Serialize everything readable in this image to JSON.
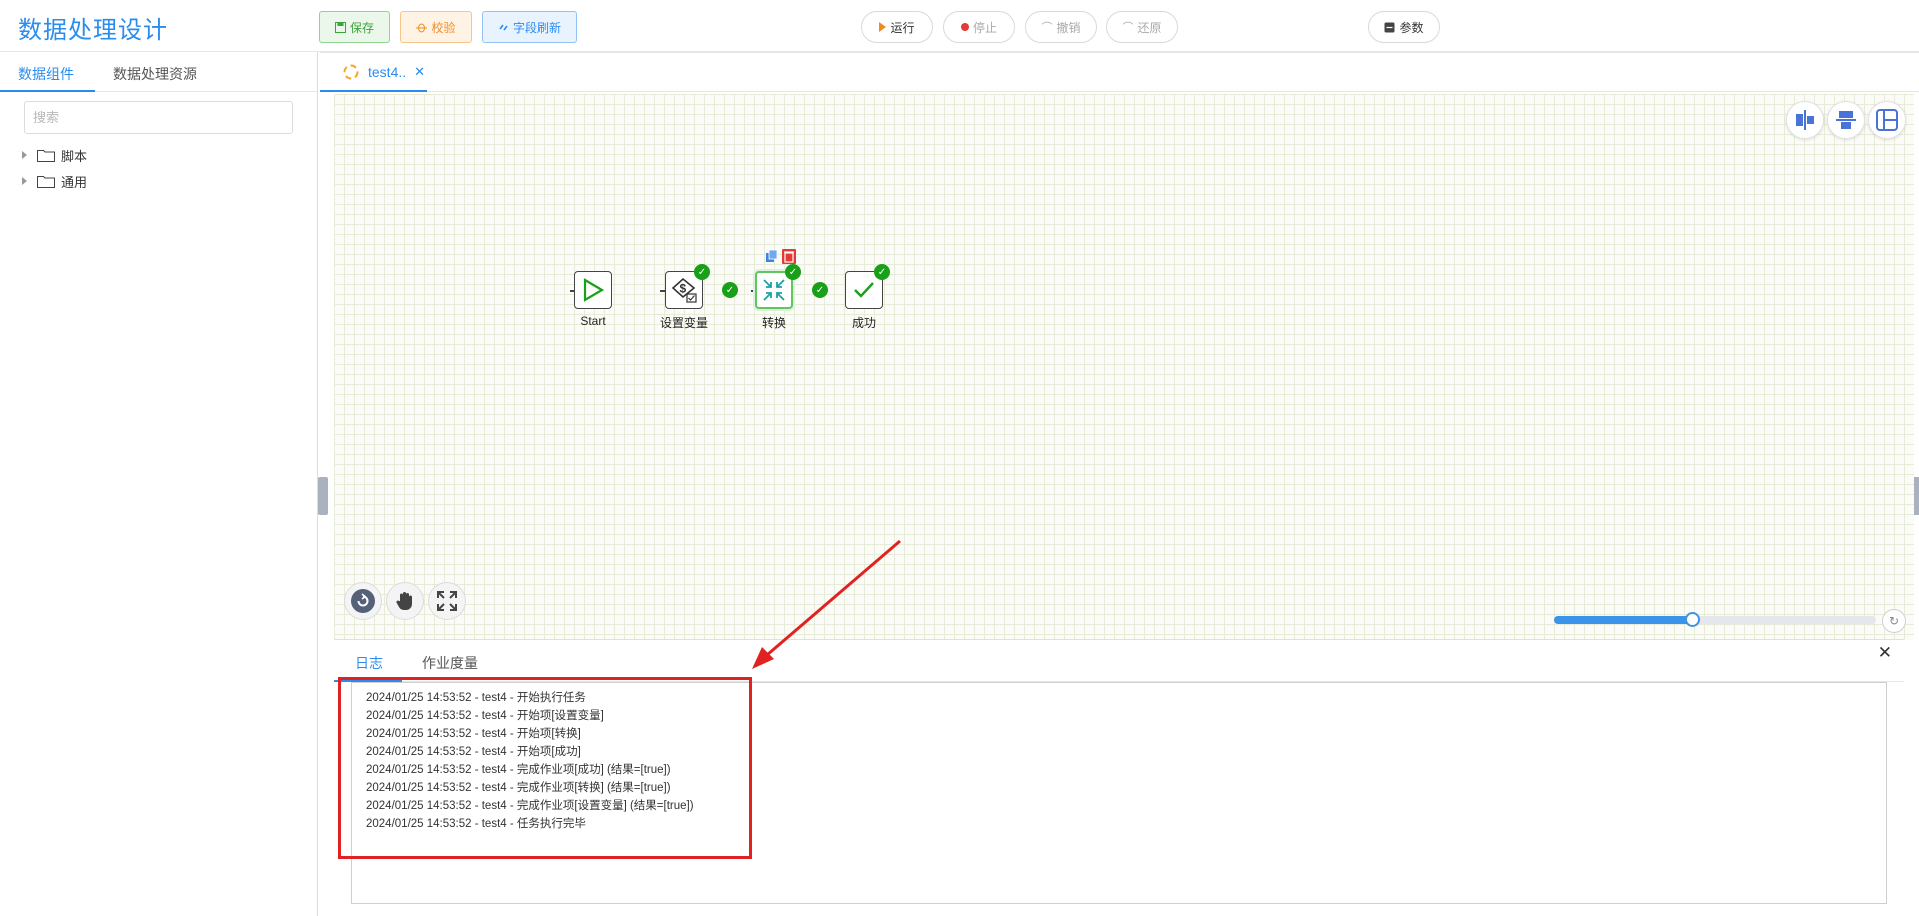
{
  "header": {
    "title": "数据处理设计",
    "save_label": "保存",
    "check_label": "校验",
    "refresh_label": "字段刷新",
    "run_label": "运行",
    "stop_label": "停止",
    "undo_label": "撤销",
    "redo_label": "还原",
    "params_label": "参数"
  },
  "sidebar": {
    "tabs": [
      {
        "label": "数据组件"
      },
      {
        "label": "数据处理资源"
      }
    ],
    "search_placeholder": "搜索",
    "tree": [
      {
        "label": "脚本"
      },
      {
        "label": "通用"
      }
    ]
  },
  "editor": {
    "tab_label": "test4..",
    "nodes": [
      {
        "label": "Start",
        "icon": "play-triangle-icon"
      },
      {
        "label": "设置变量",
        "icon": "dollar-variable-icon"
      },
      {
        "label": "转换",
        "icon": "transform-arrows-icon"
      },
      {
        "label": "成功",
        "icon": "checkmark-icon"
      }
    ],
    "zoom_fraction": 0.43,
    "colors": {
      "accent": "#2b8cf0",
      "success": "#19a019",
      "danger": "#e53935",
      "highlight": "#e02222"
    }
  },
  "log_panel": {
    "tabs": [
      {
        "label": "日志"
      },
      {
        "label": "作业度量"
      }
    ],
    "lines": [
      "2024/01/25 14:53:52 - test4 - 开始执行任务",
      "2024/01/25 14:53:52 - test4 - 开始项[设置变量]",
      "2024/01/25 14:53:52 - test4 - 开始项[转换]",
      "2024/01/25 14:53:52 - test4 - 开始项[成功]",
      "2024/01/25 14:53:52 - test4 - 完成作业项[成功] (结果=[true])",
      "2024/01/25 14:53:52 - test4 - 完成作业项[转换] (结果=[true])",
      "2024/01/25 14:53:52 - test4 - 完成作业项[设置变量] (结果=[true])",
      "2024/01/25 14:53:52 - test4 - 任务执行完毕"
    ]
  }
}
